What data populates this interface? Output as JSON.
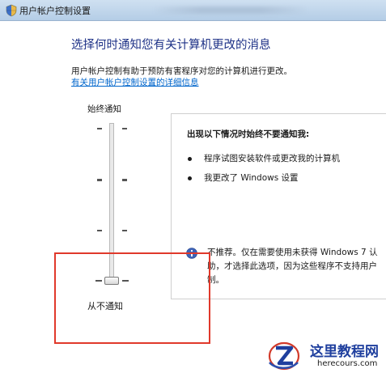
{
  "window": {
    "title": "用户帐户控制设置"
  },
  "main": {
    "heading": "选择何时通知您有关计算机更改的消息",
    "description": "用户帐户控制有助于预防有害程序对您的计算机进行更改。",
    "link": "有关用户帐户控制设置的详细信息"
  },
  "slider": {
    "top_label": "始终通知",
    "bottom_label": "从不通知",
    "level_count": 4,
    "selected_level": 0
  },
  "info": {
    "title": "出现以下情况时始终不要通知我:",
    "items": [
      "程序试图安装软件或更改我的计算机",
      "我更改了 Windows 设置"
    ],
    "warning_lines": [
      "不推荐。仅在需要使用未获得 Windows 7 认",
      "助，才选择此选项，因为这些程序不支持用户",
      "制。"
    ]
  },
  "watermark": {
    "title": "这里教程网",
    "url": "herecours.com"
  },
  "colors": {
    "heading": "#1e3287",
    "link": "#0066cc",
    "highlight": "#e0392b",
    "watermark": "#1f3f9e"
  }
}
